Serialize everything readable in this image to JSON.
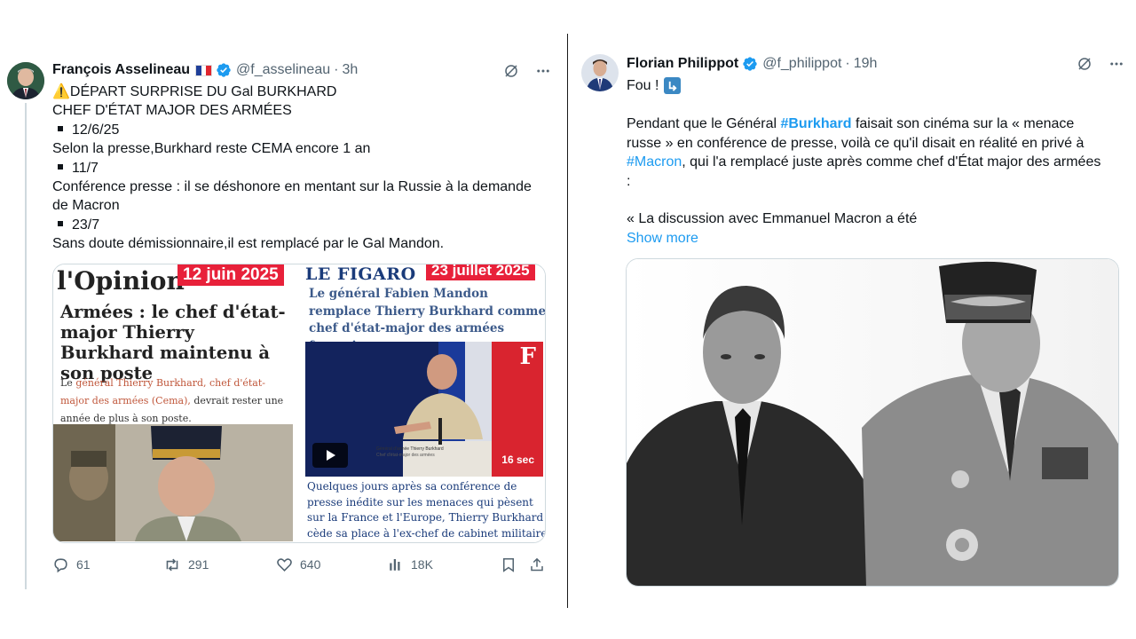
{
  "left_tweet": {
    "author_name": "François Asselineau",
    "handle": "@f_asselineau",
    "time": "3h",
    "lines": [
      "⚠️DÉPART SURPRISE DU Gal BURKHARD",
      "CHEF D'ÉTAT MAJOR DES ARMÉES",
      "12/6/25",
      "Selon la presse,Burkhard reste CEMA encore 1 an",
      "11/7",
      "Conférence presse : il se déshonore en mentant sur la Russie à la demande",
      "de Macron",
      "23/7",
      "Sans doute démissionnaire,il est remplacé par le Gal Mandon."
    ],
    "media": {
      "opinion_logo": "l'Opinion",
      "opinion_date": "12 juin 2025",
      "opinion_headline": "Armées : le chef d'état-major Thierry Burkhard maintenu à son poste",
      "opinion_lede_prefix": "Le ",
      "opinion_lede_highlight": "général Thierry Burkhard, chef d'état-major des armées (Cema),",
      "opinion_lede_suffix": " devrait rester une année de plus à son poste.",
      "figaro_logo": "LE FIGARO",
      "figaro_date": "23 juillet 2025",
      "figaro_headline": "Le général Fabien Mandon remplace Thierry Burkhard comme chef d'état-major des armées françaises",
      "video_duration": "16 sec",
      "video_caption_1": "Général d'armée Thierry Burkhard",
      "video_caption_2": "Chef d'état-major des armées",
      "figaro_body": "Quelques jours après sa conférence de presse inédite sur les menaces qui pèsent sur la France et l'Europe, Thierry Burkhard cède sa place à l'ex-chef de cabinet militaire de Sébastien"
    },
    "actions": {
      "replies": "61",
      "reposts": "291",
      "likes": "640",
      "views": "18K"
    }
  },
  "right_tweet": {
    "author_name": "Florian Philippot",
    "handle": "@f_philippot",
    "time": "19h",
    "first_line": "Fou !",
    "para_prefix": "Pendant que le Général ",
    "hashtag_burkhard": "#Burkhard",
    "para_mid": " faisait son cinéma sur la « menace",
    "para_line2": "russe » en conférence de presse, voilà ce qu'il disait en réalité en privé à",
    "hashtag_macron": "#Macron",
    "para_line3_suffix": ", qui l'a remplacé juste après comme chef d'État major des armées",
    "para_line4": ":",
    "quote_line": "« La discussion avec Emmanuel Macron a été",
    "show_more": "Show more"
  },
  "colors": {
    "link": "#1d9bf0",
    "secondary_text": "#536471",
    "verified": "#1d9bf0",
    "red_badge": "#e8213a"
  },
  "icons": [
    "verified-icon",
    "grok-icon",
    "more-icon",
    "reply-icon",
    "repost-icon",
    "like-icon",
    "views-icon",
    "bookmark-icon",
    "share-icon",
    "play-icon",
    "arrow-down-right-icon"
  ]
}
